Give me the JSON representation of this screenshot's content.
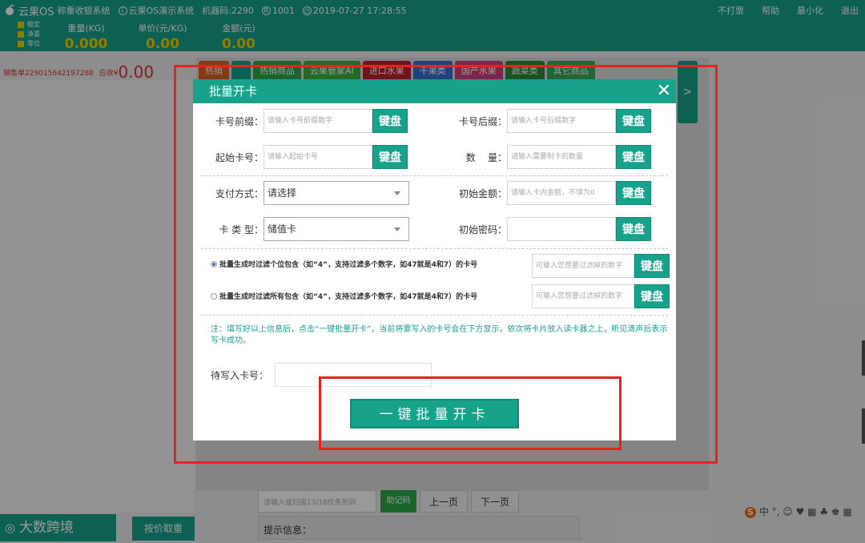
{
  "topbar": {
    "app_name": "云果OS",
    "app_sub": "称重收银系统",
    "demo_system": "云果OS演示系统",
    "machine_code": "机器码:2290",
    "user_id": "1001",
    "datetime": "2019-07-27 17:28:55",
    "right_menu": [
      "不打票",
      "帮助",
      "最小化",
      "退出"
    ],
    "status": [
      "稳定",
      "净重",
      "零位"
    ],
    "weight_label": "重量(KG)",
    "weight_value": "0.000",
    "unit_price_label": "单价(元/KG)",
    "unit_price_value": "0.00",
    "amount_label": "金额(元)",
    "amount_value": "0.00"
  },
  "sale": {
    "order_label": "销售单229015642197288",
    "receivable_label": "应收¥",
    "receivable_value": "0.00"
  },
  "categories": [
    {
      "label": "热销",
      "color": "#e06020"
    },
    {
      "label": "",
      "color": "#17a28b"
    },
    {
      "label": "热销商品",
      "color": "#2aa84a"
    },
    {
      "label": "云果管家AI",
      "color": "#40b040"
    },
    {
      "label": "进口水果",
      "color": "#c0202a"
    },
    {
      "label": "干果类",
      "color": "#3a6fd0"
    },
    {
      "label": "国产水果",
      "color": "#d0407a"
    },
    {
      "label": "蔬菜类",
      "color": "#2a8a3a"
    },
    {
      "label": "其它商品",
      "color": "#3aa85a"
    }
  ],
  "next_arrow": ">",
  "bottom": {
    "barcode_placeholder": "请输入或扫描13/18位条形码",
    "helper_btn": "助记码",
    "prev_page": "上一页",
    "next_page": "下一页",
    "tip_label": "提示信息：",
    "logo_text": "大数跨境",
    "price_btn": "按价取重",
    "ime_text": "中 °, ☺ ♥ ▦ ♣ ♚ ▦"
  },
  "modal": {
    "title": "批量开卡",
    "close": "✕",
    "fields": {
      "prefix_label": "卡号前缀：",
      "prefix_placeholder": "请输入卡号前缀数字",
      "suffix_label": "卡号后缀：",
      "suffix_placeholder": "请输入卡号后缀数字",
      "start_label": "起始卡号：",
      "start_placeholder": "请输入起始卡号",
      "qty_label": "数    量：",
      "qty_placeholder": "请输入需要制卡的数量",
      "pay_label": "支付方式：",
      "pay_value": "请选择",
      "init_amount_label": "初始金额：",
      "init_amount_placeholder": "请输入卡内金额，不填为0",
      "card_type_label": "卡 类 型：",
      "card_type_value": "储值卡",
      "init_pwd_label": "初始密码：",
      "init_pwd_placeholder": ""
    },
    "keyboard_label": "键盘",
    "filter_option_1": "批量生成时过滤个位包含（如“4”，支持过滤多个数字，如47就是4和7）的卡号",
    "filter_option_2": "批量生成时过滤所有包含（如“4”，支持过滤多个数字，如47就是4和7）的卡号",
    "filter_placeholder": "可输入您想要过滤掉的数字",
    "note": "注：填写好以上信息后，点击“一键批量开卡”，当前将要写入的卡号会在下方显示，依次将卡片放入读卡器之上，听见滴声后表示写卡成功。",
    "pending_label": "待写入卡号：",
    "submit_label": "一键批量开卡"
  }
}
